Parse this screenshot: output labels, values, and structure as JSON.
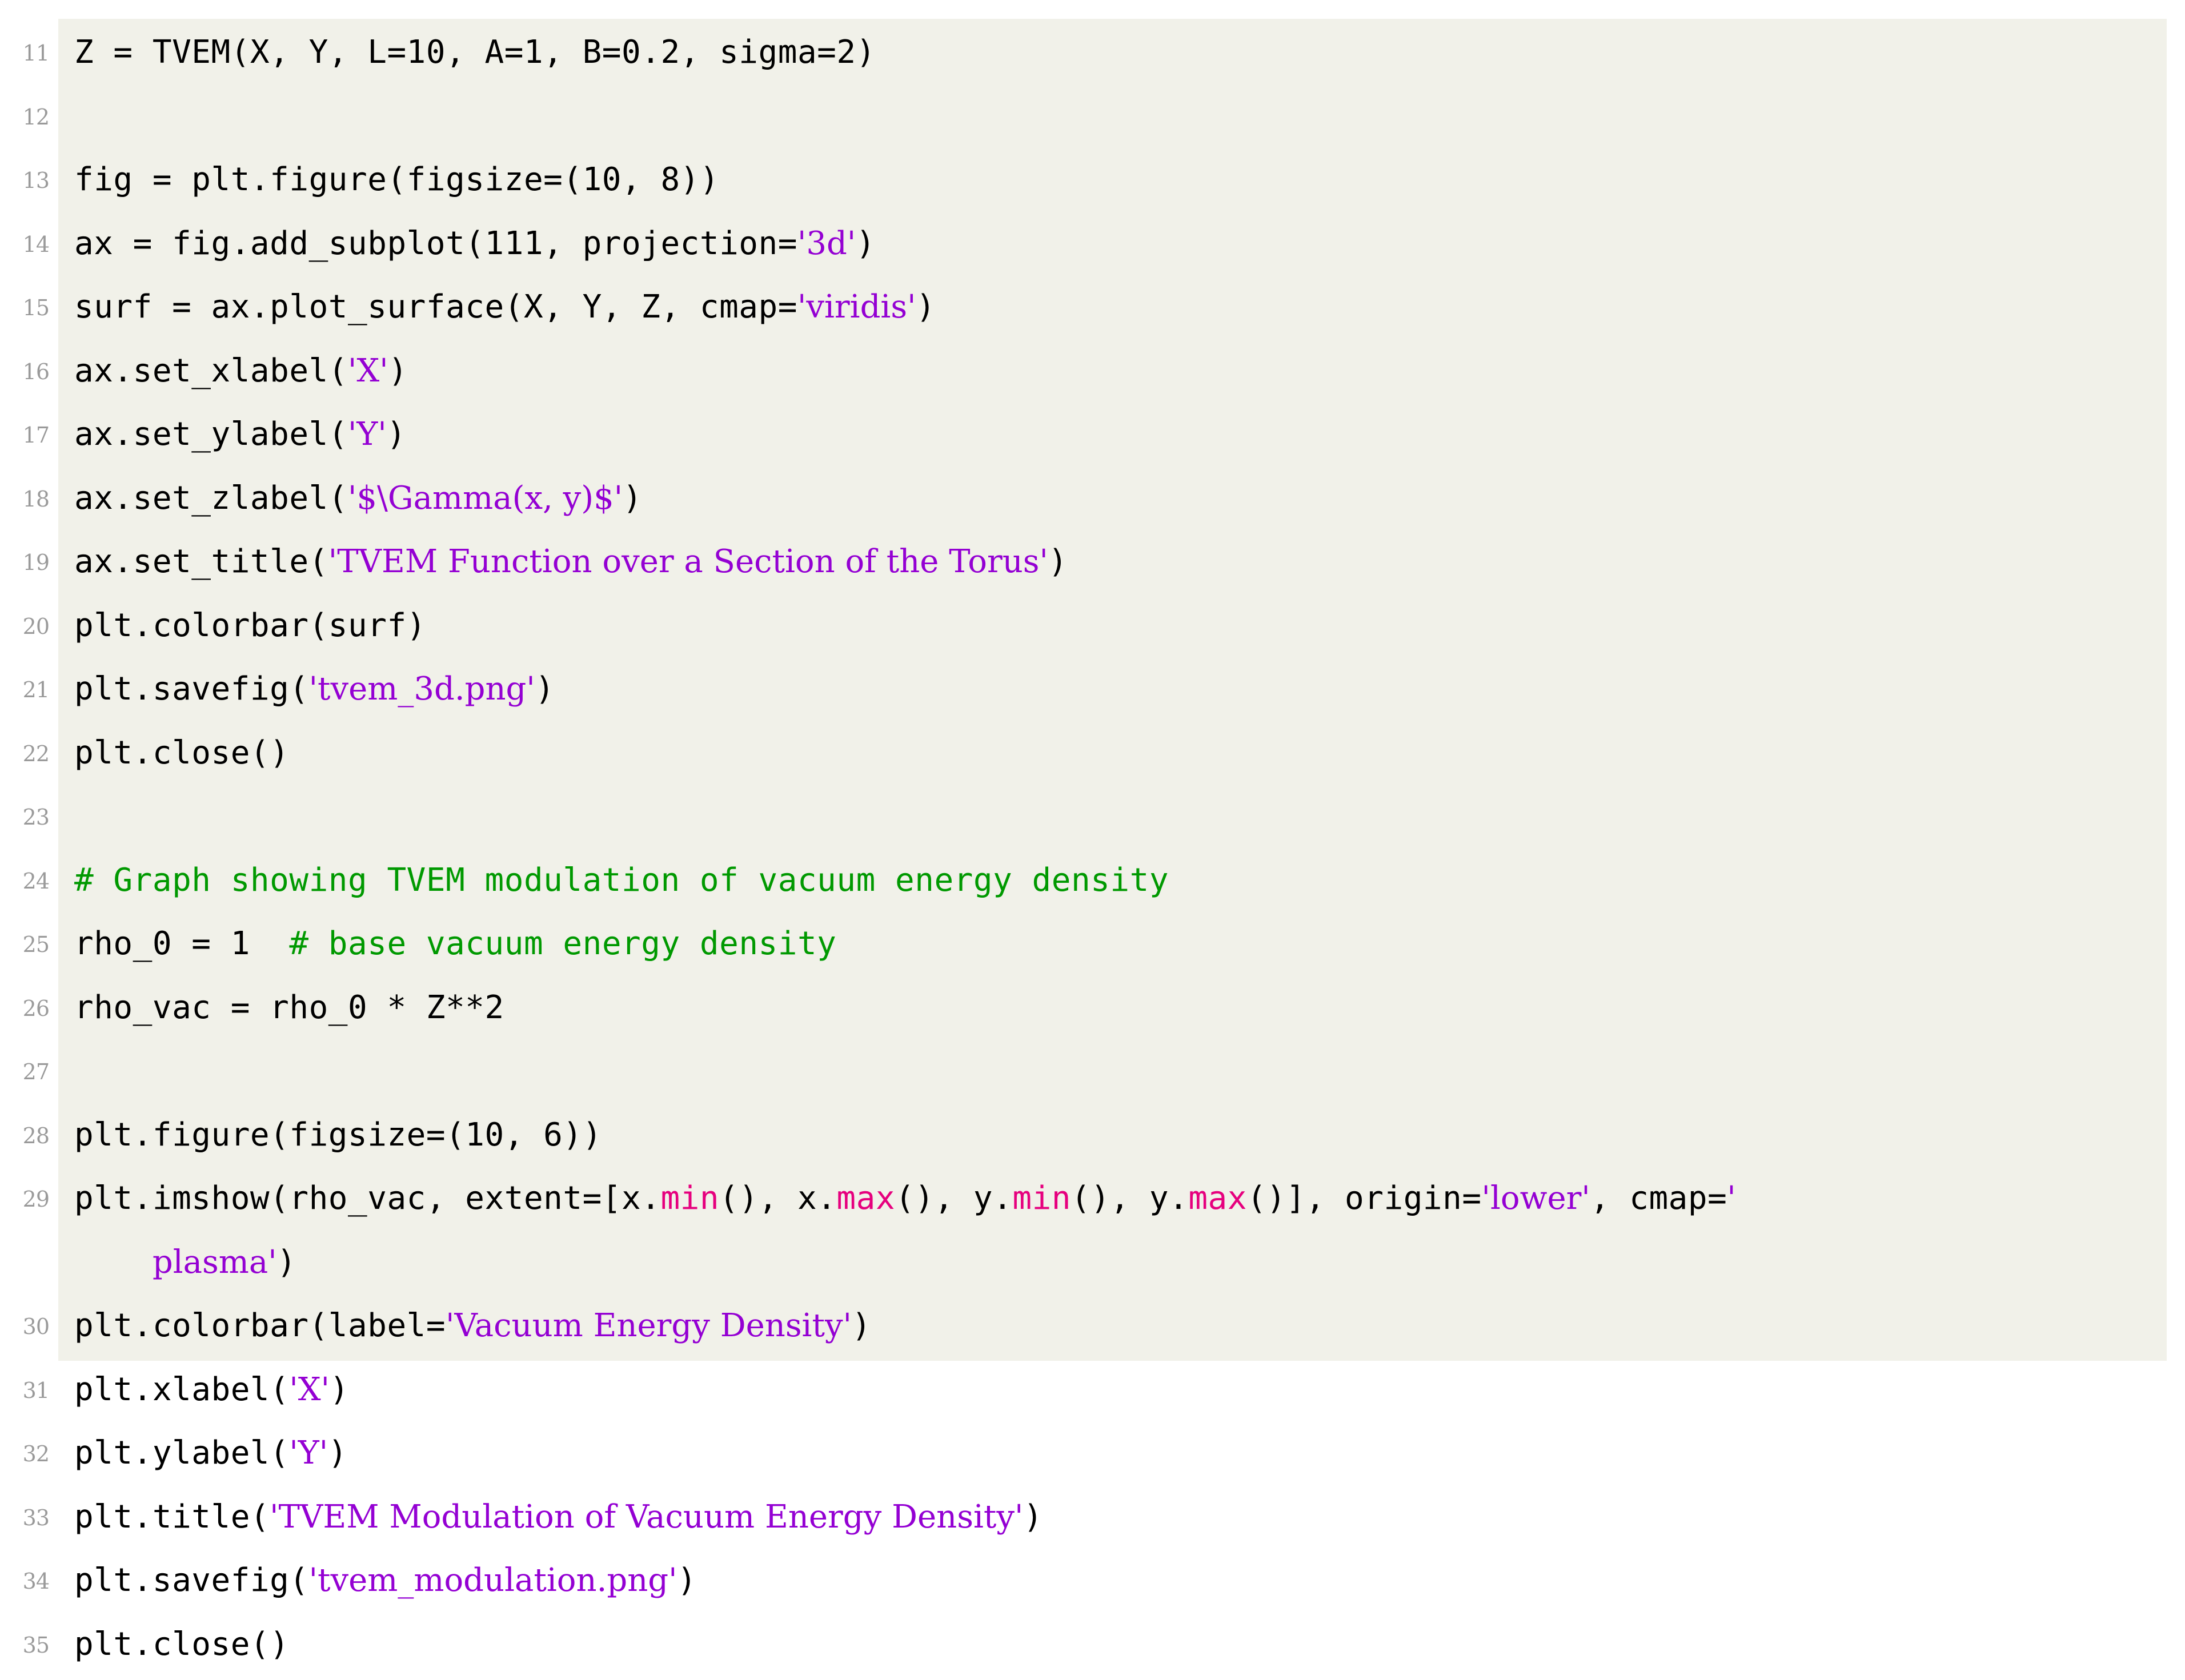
{
  "listing": {
    "language": "Python",
    "background_color": "#f1f1e9",
    "page_background_color": "#ffffff",
    "colors": {
      "plain": "#000000",
      "string": "#9400d3",
      "comment": "#009900",
      "keyword": "#e6007e",
      "line_number": "#9a9a9a"
    },
    "first_line_number": 11,
    "last_line_number": 35,
    "lines": [
      {
        "number": "11",
        "tokens": [
          {
            "t": "Z = TVEM(X, Y, L=10, A=1, B=0.2, sigma=2)",
            "c": "pln"
          }
        ]
      },
      {
        "number": "12",
        "tokens": []
      },
      {
        "number": "13",
        "tokens": [
          {
            "t": "fig = plt.figure(figsize=(10, 8))",
            "c": "pln"
          }
        ]
      },
      {
        "number": "14",
        "tokens": [
          {
            "t": "ax = fig.add_subplot(111, projection=",
            "c": "pln"
          },
          {
            "t": "'3d'",
            "c": "str"
          },
          {
            "t": ")",
            "c": "pln"
          }
        ]
      },
      {
        "number": "15",
        "tokens": [
          {
            "t": "surf = ax.plot_surface(X, Y, Z, cmap=",
            "c": "pln"
          },
          {
            "t": "'viridis'",
            "c": "str"
          },
          {
            "t": ")",
            "c": "pln"
          }
        ]
      },
      {
        "number": "16",
        "tokens": [
          {
            "t": "ax.set_xlabel(",
            "c": "pln"
          },
          {
            "t": "'X'",
            "c": "str"
          },
          {
            "t": ")",
            "c": "pln"
          }
        ]
      },
      {
        "number": "17",
        "tokens": [
          {
            "t": "ax.set_ylabel(",
            "c": "pln"
          },
          {
            "t": "'Y'",
            "c": "str"
          },
          {
            "t": ")",
            "c": "pln"
          }
        ]
      },
      {
        "number": "18",
        "tokens": [
          {
            "t": "ax.set_zlabel(",
            "c": "pln"
          },
          {
            "t": "'$\\Gamma(x, y)$'",
            "c": "str"
          },
          {
            "t": ")",
            "c": "pln"
          }
        ]
      },
      {
        "number": "19",
        "tokens": [
          {
            "t": "ax.set_title(",
            "c": "pln"
          },
          {
            "t": "'TVEM Function over a Section of the Torus'",
            "c": "str"
          },
          {
            "t": ")",
            "c": "pln"
          }
        ]
      },
      {
        "number": "20",
        "tokens": [
          {
            "t": "plt.colorbar(surf)",
            "c": "pln"
          }
        ]
      },
      {
        "number": "21",
        "tokens": [
          {
            "t": "plt.savefig(",
            "c": "pln"
          },
          {
            "t": "'tvem_3d.png'",
            "c": "str"
          },
          {
            "t": ")",
            "c": "pln"
          }
        ]
      },
      {
        "number": "22",
        "tokens": [
          {
            "t": "plt.close()",
            "c": "pln"
          }
        ]
      },
      {
        "number": "23",
        "tokens": []
      },
      {
        "number": "24",
        "tokens": [
          {
            "t": "# Graph showing TVEM modulation of vacuum energy density",
            "c": "cmt"
          }
        ]
      },
      {
        "number": "25",
        "tokens": [
          {
            "t": "rho_0 = 1  ",
            "c": "pln"
          },
          {
            "t": "# base vacuum energy density",
            "c": "cmt"
          }
        ]
      },
      {
        "number": "26",
        "tokens": [
          {
            "t": "rho_vac = rho_0 * Z**2",
            "c": "pln"
          }
        ]
      },
      {
        "number": "27",
        "tokens": []
      },
      {
        "number": "28",
        "tokens": [
          {
            "t": "plt.figure(figsize=(10, 6))",
            "c": "pln"
          }
        ]
      },
      {
        "number": "29",
        "tokens": [
          {
            "t": "plt.imshow(rho_vac, extent=[x.",
            "c": "pln"
          },
          {
            "t": "min",
            "c": "kw"
          },
          {
            "t": "(), x.",
            "c": "pln"
          },
          {
            "t": "max",
            "c": "kw"
          },
          {
            "t": "(), y.",
            "c": "pln"
          },
          {
            "t": "min",
            "c": "kw"
          },
          {
            "t": "(), y.",
            "c": "pln"
          },
          {
            "t": "max",
            "c": "kw"
          },
          {
            "t": "()], origin=",
            "c": "pln"
          },
          {
            "t": "'lower'",
            "c": "str"
          },
          {
            "t": ", cmap=",
            "c": "pln"
          },
          {
            "t": "'",
            "c": "str"
          }
        ]
      },
      {
        "number": "",
        "tokens": [
          {
            "t": "    ",
            "c": "pln"
          },
          {
            "t": "plasma'",
            "c": "str"
          },
          {
            "t": ")",
            "c": "pln"
          }
        ]
      },
      {
        "number": "30",
        "tokens": [
          {
            "t": "plt.colorbar(label=",
            "c": "pln"
          },
          {
            "t": "'Vacuum Energy Density'",
            "c": "str"
          },
          {
            "t": ")",
            "c": "pln"
          }
        ]
      },
      {
        "number": "31",
        "tokens": [
          {
            "t": "plt.xlabel(",
            "c": "pln"
          },
          {
            "t": "'X'",
            "c": "str"
          },
          {
            "t": ")",
            "c": "pln"
          }
        ]
      },
      {
        "number": "32",
        "tokens": [
          {
            "t": "plt.ylabel(",
            "c": "pln"
          },
          {
            "t": "'Y'",
            "c": "str"
          },
          {
            "t": ")",
            "c": "pln"
          }
        ]
      },
      {
        "number": "33",
        "tokens": [
          {
            "t": "plt.title(",
            "c": "pln"
          },
          {
            "t": "'TVEM Modulation of Vacuum Energy Density'",
            "c": "str"
          },
          {
            "t": ")",
            "c": "pln"
          }
        ]
      },
      {
        "number": "34",
        "tokens": [
          {
            "t": "plt.savefig(",
            "c": "pln"
          },
          {
            "t": "'tvem_modulation.png'",
            "c": "str"
          },
          {
            "t": ")",
            "c": "pln"
          }
        ]
      },
      {
        "number": "35",
        "tokens": [
          {
            "t": "plt.close()",
            "c": "pln"
          }
        ]
      }
    ]
  }
}
